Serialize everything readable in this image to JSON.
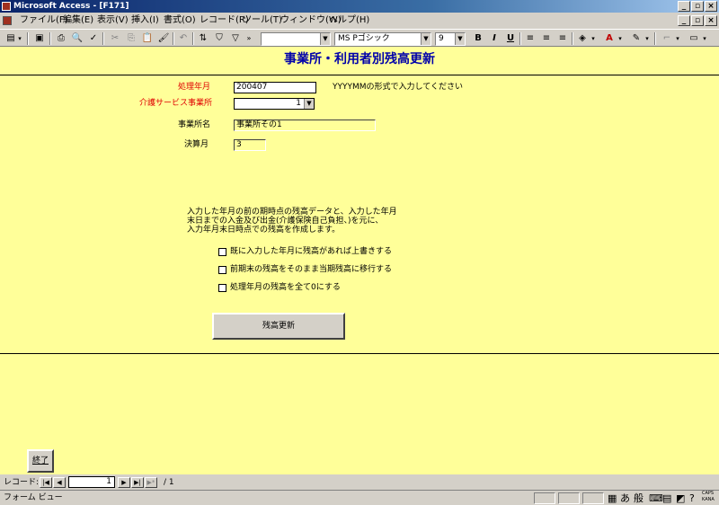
{
  "window": {
    "title": "Microsoft Access - [F171]"
  },
  "menu": [
    "ファイル(F)",
    "編集(E)",
    "表示(V)",
    "挿入(I)",
    "書式(O)",
    "レコード(R)",
    "ツール(T)",
    "ウィンドウ(W)",
    "ヘルプ(H)"
  ],
  "toolbar": {
    "font_name": "MS Pゴシック",
    "font_size": "9",
    "bold": "B",
    "italic": "I",
    "underline": "U"
  },
  "form": {
    "title": "事業所・利用者別残高更新",
    "month_label": "処理年月",
    "month_value": "200407",
    "month_hint": "YYYYMMの形式で入力してください",
    "service_label": "介護サービス事業所",
    "service_value": "1",
    "office_label": "事業所名",
    "office_value": "事業所その1",
    "settle_label": "決算月",
    "settle_value": "3",
    "description": [
      "入力した年月の前の期時点の残高データと、入力した年月",
      "末日までの入金及び出金(介護保険自己負担、)を元に、",
      "入力年月末日時点での残高を作成します。"
    ],
    "options": [
      "既に入力した年月に残高があれば上書きする",
      "前期末の残高をそのまま当期残高に移行する",
      "処理年月の残高を全て0にする"
    ],
    "update_button": "残高更新",
    "close_button": "終了"
  },
  "nav": {
    "label": "レコード:",
    "record": "1",
    "total": "/ 1"
  },
  "status": {
    "text": "フォーム ビュー",
    "ime1": "あ",
    "ime2": "般",
    "caps": "CAPS",
    "kana": "KANA"
  }
}
